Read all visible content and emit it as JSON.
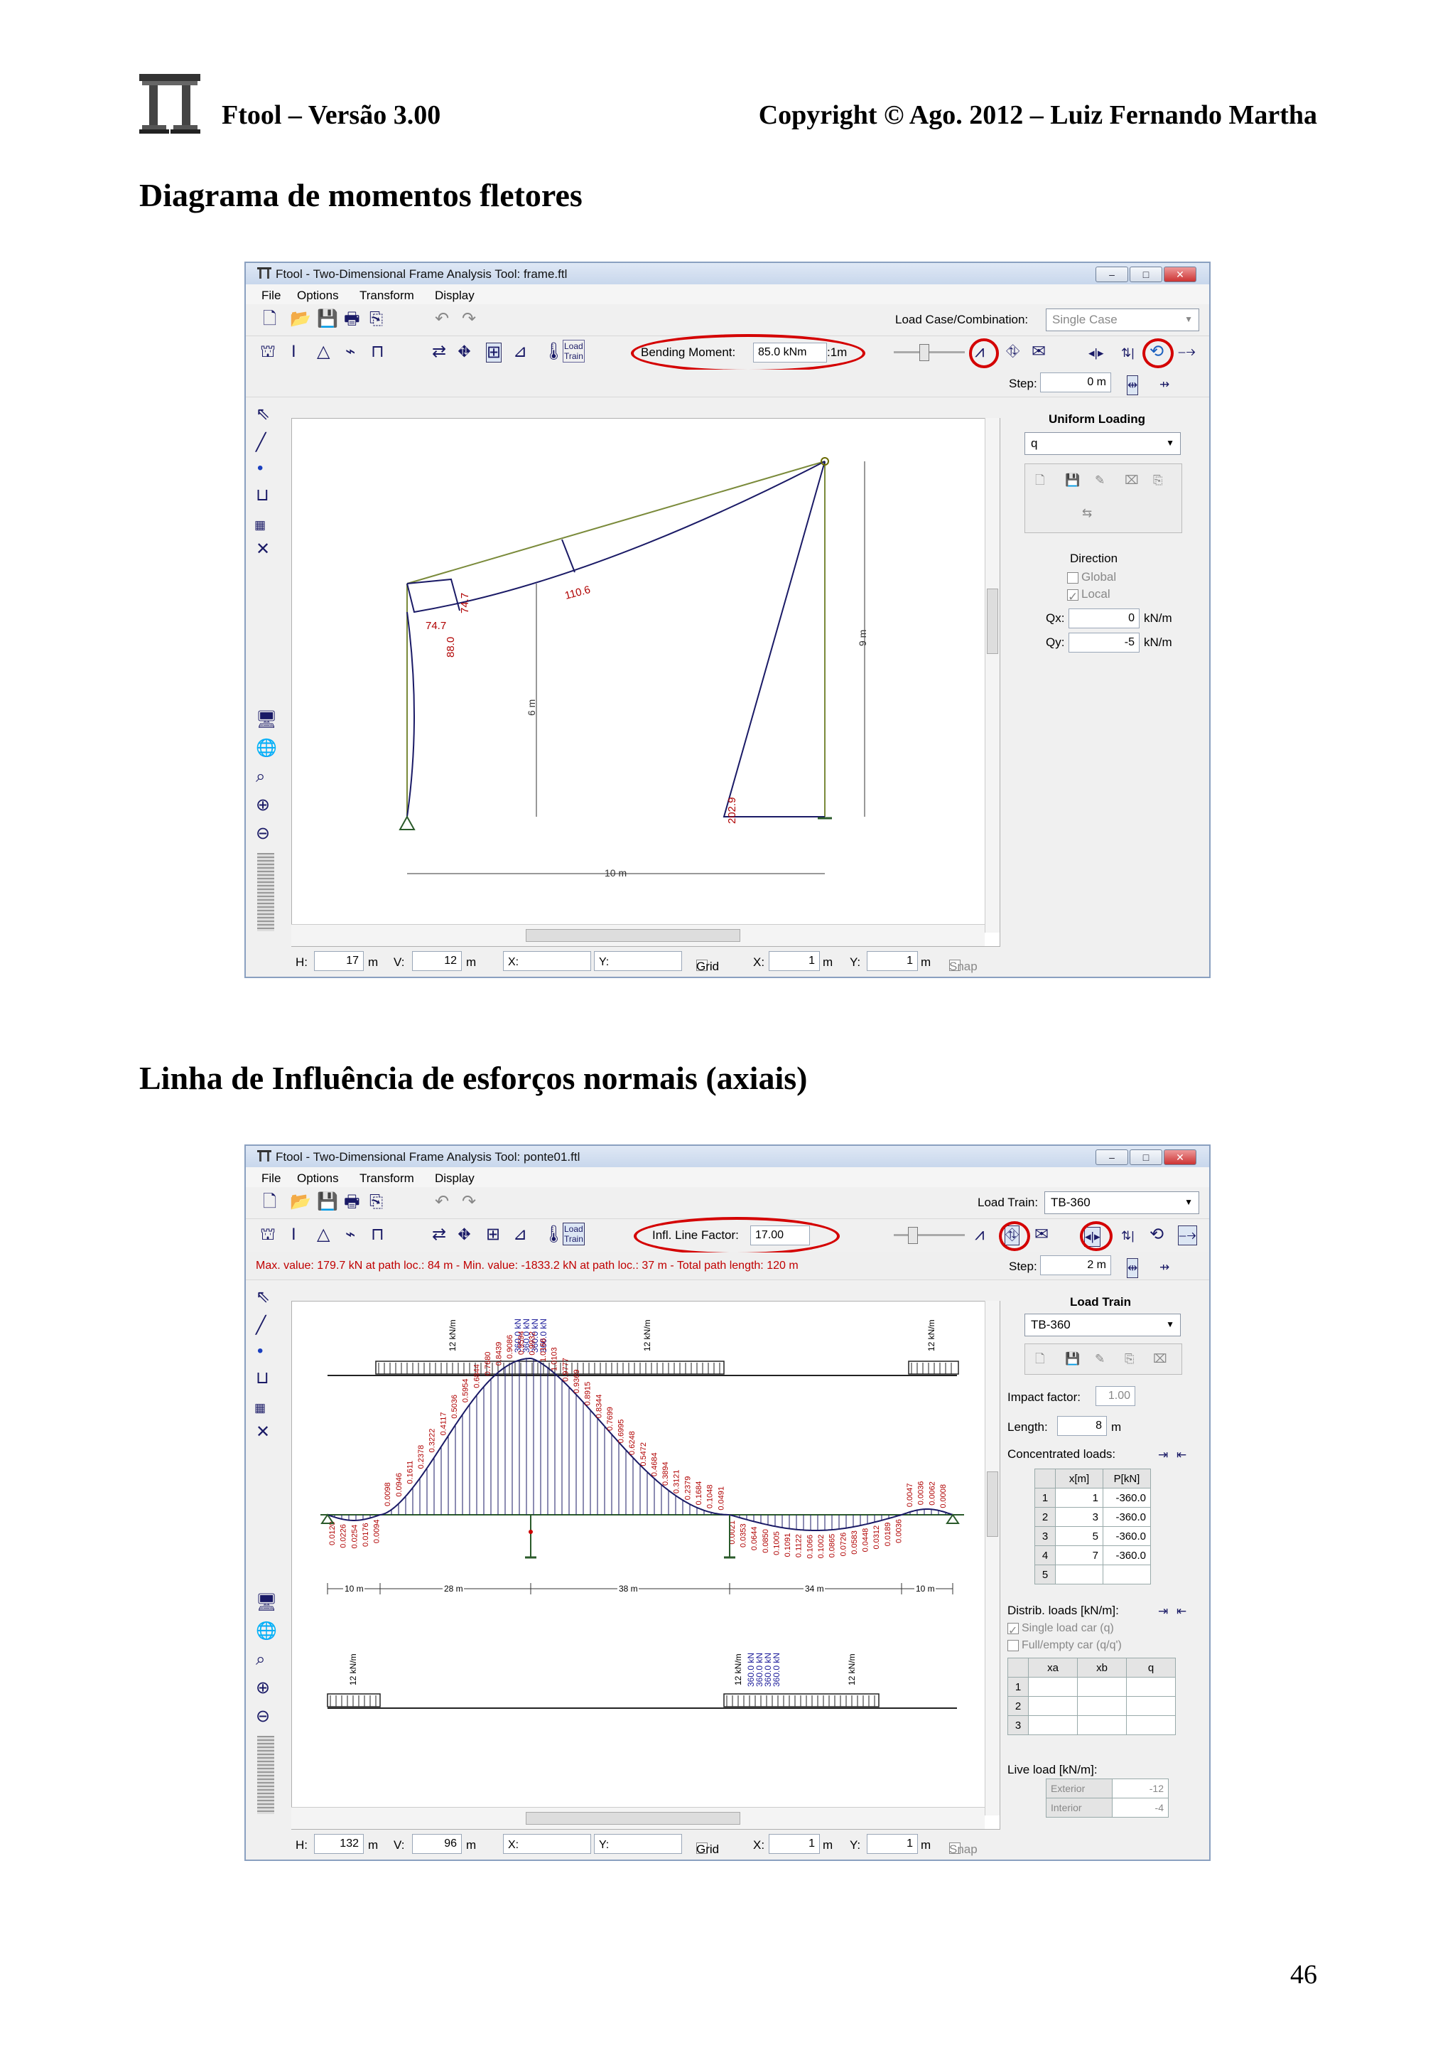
{
  "page": {
    "header_left": "Ftool – Versão 3.00",
    "header_right": "Copyright © Ago. 2012 – Luiz Fernando Martha",
    "section1_title": "Diagrama de momentos fletores",
    "section2_title": "Linha de Influência de esforços normais (axiais)",
    "page_number": "46"
  },
  "win1": {
    "title": "Ftool - Two-Dimensional Frame Analysis Tool: frame.ftl",
    "menu": [
      "File",
      "Options",
      "Transform",
      "Display"
    ],
    "combo_label": "Load Case/Combination:",
    "combo_value": "Single Case",
    "toolbar_label": "Bending Moment:",
    "toolbar_value": "85.0 kNm",
    "toolbar_scale": ":1m",
    "step_label": "Step:",
    "step_value": "0 m",
    "panel_title": "Uniform Loading",
    "panel_select": "q",
    "direction_label": "Direction",
    "global_label": "Global",
    "local_label": "Local",
    "qx_label": "Qx:",
    "qx_value": "0",
    "qy_label": "Qy:",
    "qy_value": "-5",
    "unit": "kN/m",
    "canvas": {
      "labels": [
        "74.7",
        "74.7",
        "110.6",
        "88.0",
        "202.9",
        "6 m",
        "9 m",
        "10 m"
      ]
    },
    "status": {
      "h_label": "H:",
      "h_value": "17",
      "v_label": "V:",
      "v_value": "12",
      "m": "m",
      "x_label": "X:",
      "y_label": "Y:",
      "grid": "Grid",
      "gx": "1",
      "gy": "1",
      "snap": "Snap"
    }
  },
  "win2": {
    "title": "Ftool - Two-Dimensional Frame Analysis Tool: ponte01.ftl",
    "menu": [
      "File",
      "Options",
      "Transform",
      "Display"
    ],
    "combo_label": "Load Train:",
    "combo_value": "TB-360",
    "toolbar_label": "Infl. Line Factor:",
    "toolbar_value": "17.00",
    "info": "Max. value: 179.7 kN at path loc.: 84 m  -  Min. value: -1833.2 kN at path loc.: 37 m  -  Total path length: 120 m",
    "step_label": "Step:",
    "step_value": "2 m",
    "panel_title": "Load Train",
    "panel_select": "TB-360",
    "impact_label": "Impact factor:",
    "impact_value": "1.00",
    "length_label": "Length:",
    "length_value": "8",
    "length_unit": "m",
    "conc_label": "Concentrated loads:",
    "conc_headers": [
      "x[m]",
      "P[kN]"
    ],
    "conc_rows": [
      [
        "1",
        "1",
        "-360.0"
      ],
      [
        "2",
        "3",
        "-360.0"
      ],
      [
        "3",
        "5",
        "-360.0"
      ],
      [
        "4",
        "7",
        "-360.0"
      ],
      [
        "5",
        "",
        ""
      ]
    ],
    "distrib_label": "Distrib. loads [kN/m]:",
    "single_car": "Single load car (q)",
    "full_empty": "Full/empty car (q/q')",
    "distrib_headers": [
      "xa",
      "xb",
      "q"
    ],
    "distrib_rows": [
      "1",
      "2",
      "3"
    ],
    "live_label": "Live load [kN/m]:",
    "exterior_label": "Exterior",
    "exterior_value": "-12",
    "interior_label": "Interior",
    "interior_value": "-4",
    "canvas": {
      "dims": [
        "10 m",
        "28 m",
        "38 m",
        "34 m",
        "10 m"
      ],
      "load_labels": [
        "12 kN/m",
        "360.0 kN",
        "360.0 kN",
        "360.0 kN",
        "360.0 kN",
        "12 kN/m",
        "12 kN/m",
        "12 kN/m",
        "12 kN/m"
      ],
      "infl_labels": [
        "0.0120",
        "0.0226",
        "0.0254",
        "0.0176",
        "0.0094",
        "0.0098",
        "0.0946",
        "0.1611",
        "0.2378",
        "0.3222",
        "0.4117",
        "0.5036",
        "0.5954",
        "0.6844",
        "0.7680",
        "0.8439",
        "0.9086",
        "0.9594",
        "0.9932",
        "1.0166",
        "1.0103",
        "0.9777",
        "0.9369",
        "0.8915",
        "0.8344",
        "0.7699",
        "0.6995",
        "0.6248",
        "0.5472",
        "0.4684",
        "0.3894",
        "0.3121",
        "0.2379",
        "0.1684",
        "0.1048",
        "0.0491",
        "0.0021",
        "0.0353",
        "0.0644",
        "0.0850",
        "0.1005",
        "0.1091",
        "0.1122",
        "0.1066",
        "0.1002",
        "0.0865",
        "0.0726",
        "0.0583",
        "0.0448",
        "0.0312",
        "0.0189",
        "0.0036",
        "0.0047",
        "0.0036",
        "0.0062",
        "0.0008"
      ]
    },
    "status": {
      "h_label": "H:",
      "h_value": "132",
      "v_label": "V:",
      "v_value": "96",
      "m": "m",
      "x_label": "X:",
      "y_label": "Y:",
      "grid": "Grid",
      "gx": "1",
      "gy": "1",
      "snap": "Snap"
    }
  }
}
